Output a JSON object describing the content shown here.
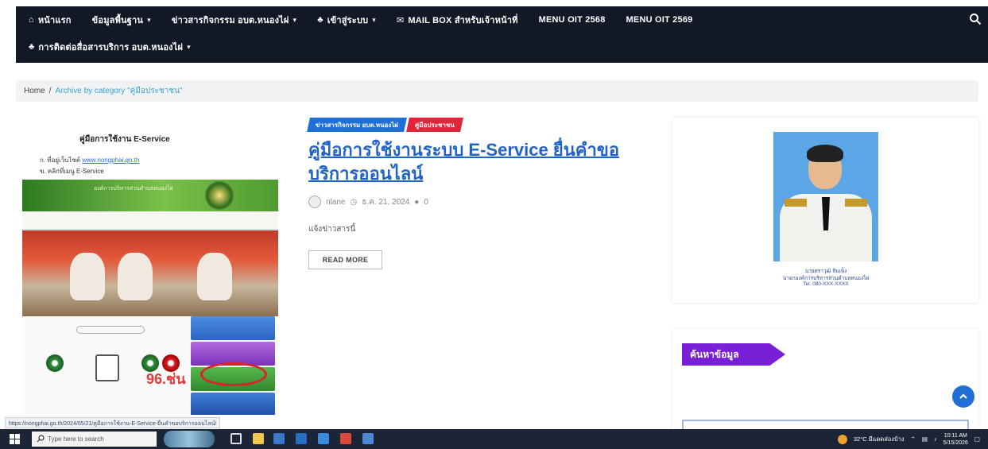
{
  "nav": {
    "items": [
      {
        "label": "หน้าแรก",
        "icon": "home-icon",
        "dropdown": false
      },
      {
        "label": "ข้อมูลพื้นฐาน",
        "dropdown": true
      },
      {
        "label": "ข่าวสารกิจกรรม อบต.หนองไผ่",
        "dropdown": true
      },
      {
        "label": "เข้าสู่ระบบ",
        "icon": "user-group-icon",
        "dropdown": true
      },
      {
        "label": "MAIL BOX สำหรับเจ้าหน้าที่",
        "icon": "mail-icon",
        "dropdown": false
      },
      {
        "label": "MENU OIT 2568",
        "dropdown": false
      },
      {
        "label": "MENU OIT 2569",
        "dropdown": false
      }
    ],
    "row2": {
      "label": "การติดต่อสื่อสารบริการ อบต.หนองไผ่",
      "icon": "user-group-icon",
      "dropdown": true
    },
    "search_icon": "search-icon"
  },
  "breadcrumb": {
    "home": "Home",
    "separator": "/",
    "current": "Archive by category \"คู่มือประชาชน\""
  },
  "thumbnail": {
    "doc_title": "คู่มือการใช้งาน E-Service",
    "line1_prefix": "ก. ที่อยู่เว็บไซต์",
    "line1_link": "www.nongphai.go.th",
    "line2": "ข. คลิกที่เมนู E-Service",
    "banner_text": "องค์การบริหารส่วนตำบลหนองไผ่",
    "badge_text": "96.ช่น"
  },
  "post": {
    "categories": [
      {
        "label": "ข่าวสารกิจกรรม อบต.หนองไผ่",
        "color": "#1f6fd6"
      },
      {
        "label": "คู่มือประชาชน",
        "color": "#e0243a"
      }
    ],
    "title": "คู่มือการใช้งานระบบ E-Service ยื่นคำขอบริการออนไลน์",
    "author": "nlane",
    "date": "ธ.ค. 21, 2024",
    "comments": "0",
    "excerpt": "แจ้งข่าวสารนี้",
    "read_more": "READ MORE"
  },
  "sidebar": {
    "profile": {
      "name": "นายศราวุฒิ สินเพ็ง",
      "position": "นายกองค์การบริหารส่วนตำบลหนองไผ่",
      "phone": "Tel. 080-XXX-XXXX"
    },
    "search_title": "ค้นหาข้อมูล"
  },
  "status_url": "https://nongphai.go.th/2024/05/21/คู่มือการใช้งาน-E-Service-ยื่นคำขอบริการออนไลน์/",
  "taskbar": {
    "search_placeholder": "Type here to search",
    "weather": "32°C มีแดดส่องบ้าง",
    "time": "10:11 AM",
    "date": "5/15/2026"
  },
  "colors": {
    "nav_bg": "#121826",
    "accent_blue": "#1f6fd6",
    "accent_red": "#e0243a",
    "search_tag": "#7a1fd8"
  }
}
